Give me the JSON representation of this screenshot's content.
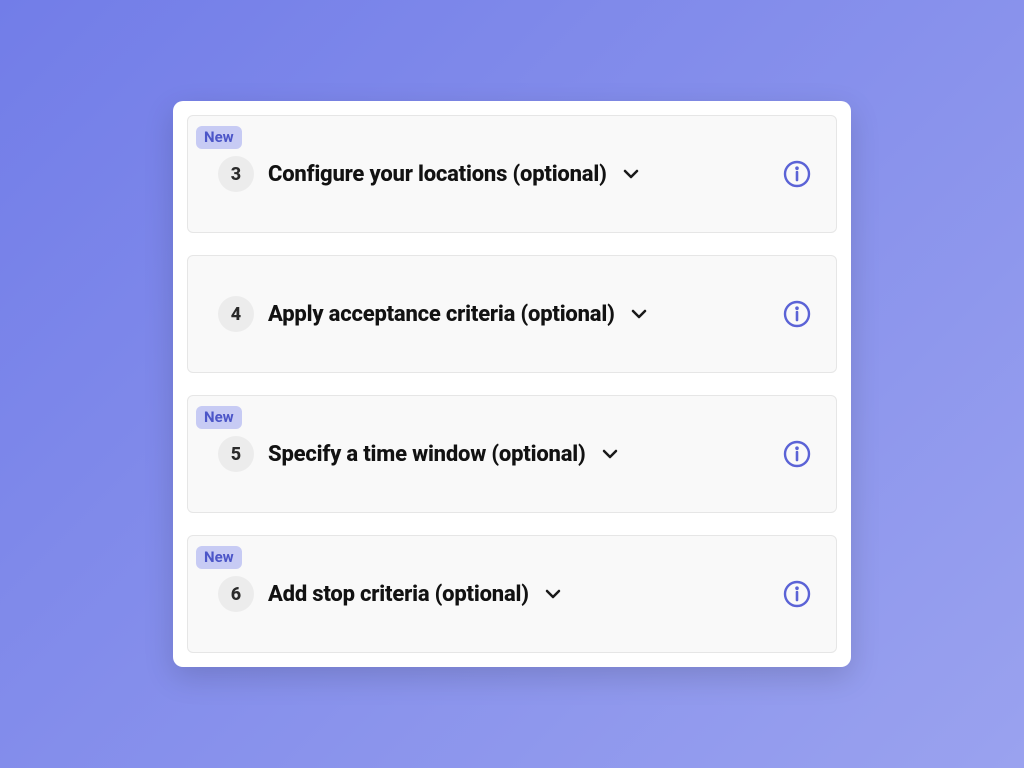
{
  "colors": {
    "accent": "#5B63D6",
    "badge_bg": "#C7CBF4",
    "badge_fg": "#4C56C8",
    "panel_bg": "#FFFFFF",
    "card_bg": "#F9F9F9",
    "card_border": "#E6E6E6",
    "gradient_from": "#727DE8",
    "gradient_to": "#9AA2EF"
  },
  "badge_label": "New",
  "icons": {
    "chevron": "chevron-down-icon",
    "info": "info-icon"
  },
  "steps": [
    {
      "number": "3",
      "title": "Configure your locations (optional)",
      "new": true
    },
    {
      "number": "4",
      "title": "Apply acceptance criteria (optional)",
      "new": false
    },
    {
      "number": "5",
      "title": "Specify a time window (optional)",
      "new": true
    },
    {
      "number": "6",
      "title": "Add stop criteria (optional)",
      "new": true
    }
  ]
}
